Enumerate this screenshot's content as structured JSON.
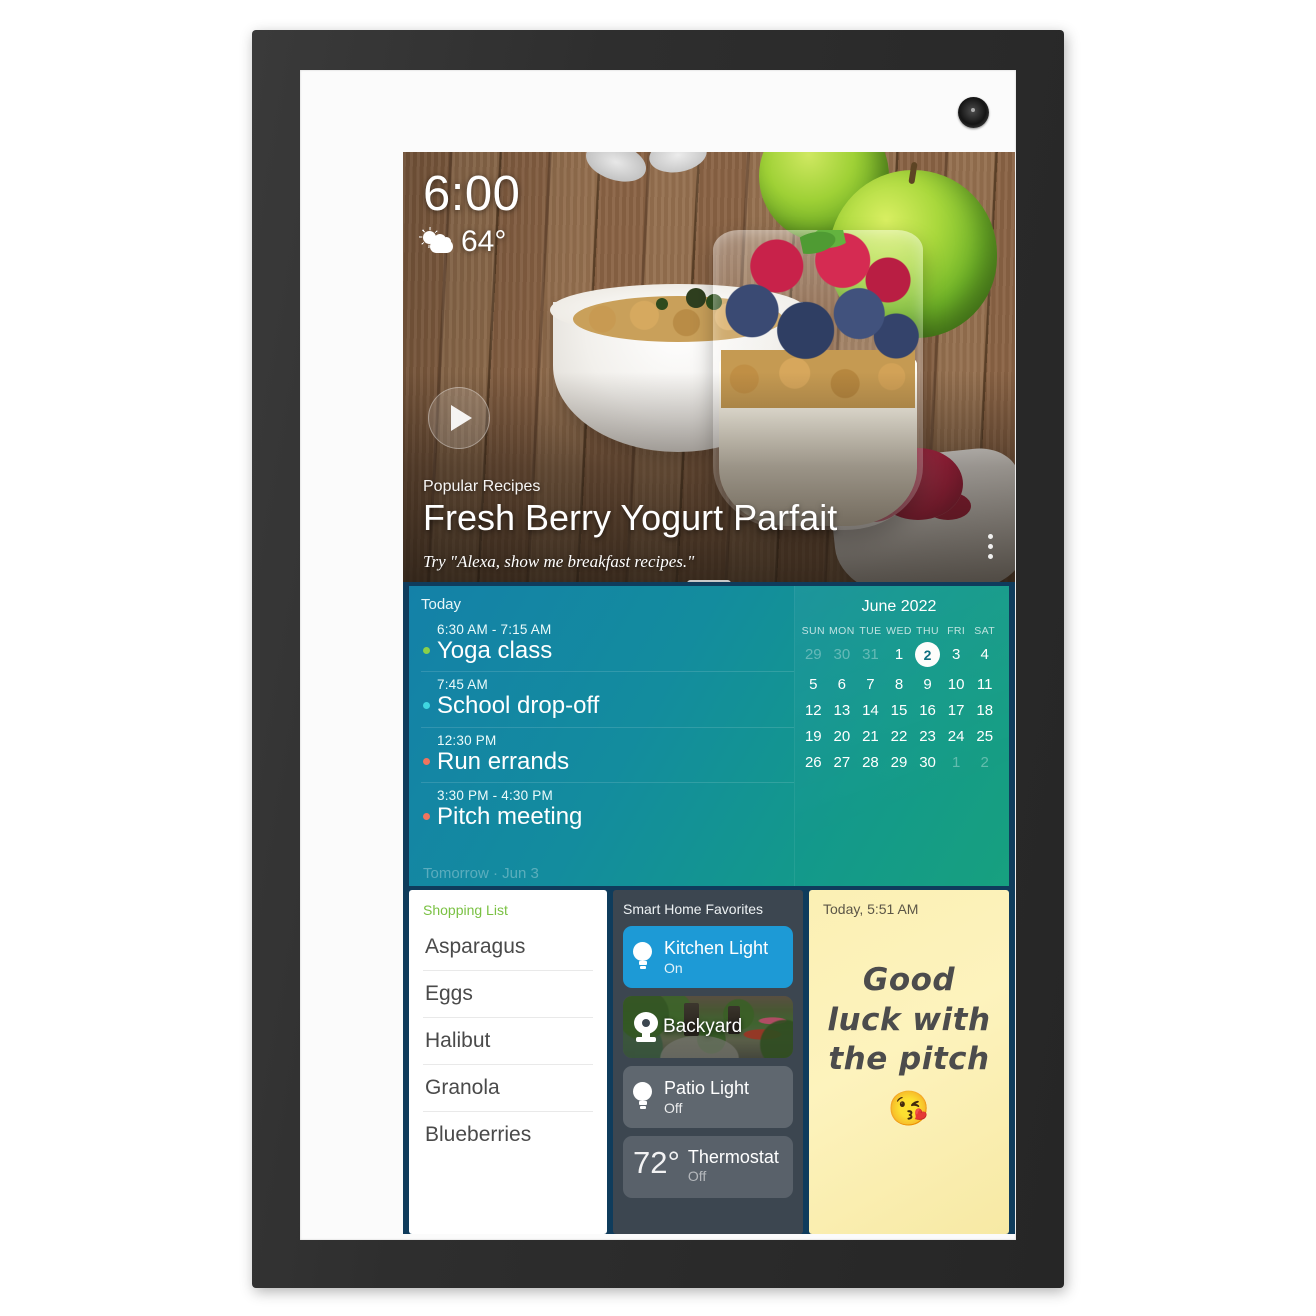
{
  "device": {
    "camera_icon": "camera-lens"
  },
  "status": {
    "time": "6:00",
    "temperature": "64°",
    "weather_icon": "partly-cloudy-icon"
  },
  "hero": {
    "eyebrow": "Popular Recipes",
    "title": "Fresh Berry Yogurt Parfait",
    "hint": "Try \"Alexa, show me breakfast recipes.\"",
    "play_icon": "play-icon",
    "overflow_icon": "more-vertical-icon",
    "grabber_icon": "drag-handle-icon"
  },
  "agenda": {
    "header": "Today",
    "footer": "Tomorrow · Jun 3",
    "events": [
      {
        "time": "6:30 AM - 7:15 AM",
        "name": "Yoga class",
        "dot_color": "#8ad04a"
      },
      {
        "time": "7:45 AM",
        "name": "School drop-off",
        "dot_color": "#3fd6e0"
      },
      {
        "time": "12:30 PM",
        "name": "Run errands",
        "dot_color": "#f0745e"
      },
      {
        "time": "3:30 PM - 4:30 PM",
        "name": "Pitch meeting",
        "dot_color": "#f0745e"
      }
    ]
  },
  "calendar": {
    "title": "June 2022",
    "weekdays": [
      "SUN",
      "MON",
      "TUE",
      "WED",
      "THU",
      "FRI",
      "SAT"
    ],
    "selected_day": 2,
    "weeks": [
      [
        {
          "n": "29",
          "mute": true
        },
        {
          "n": "30",
          "mute": true
        },
        {
          "n": "31",
          "mute": true
        },
        {
          "n": "1"
        },
        {
          "n": "2",
          "sel": true
        },
        {
          "n": "3"
        },
        {
          "n": "4"
        }
      ],
      [
        {
          "n": "5"
        },
        {
          "n": "6"
        },
        {
          "n": "7"
        },
        {
          "n": "8"
        },
        {
          "n": "9"
        },
        {
          "n": "10"
        },
        {
          "n": "11"
        }
      ],
      [
        {
          "n": "12"
        },
        {
          "n": "13"
        },
        {
          "n": "14"
        },
        {
          "n": "15"
        },
        {
          "n": "16"
        },
        {
          "n": "17"
        },
        {
          "n": "18"
        }
      ],
      [
        {
          "n": "19"
        },
        {
          "n": "20"
        },
        {
          "n": "21"
        },
        {
          "n": "22"
        },
        {
          "n": "23"
        },
        {
          "n": "24"
        },
        {
          "n": "25"
        }
      ],
      [
        {
          "n": "26"
        },
        {
          "n": "27"
        },
        {
          "n": "28"
        },
        {
          "n": "29"
        },
        {
          "n": "30"
        },
        {
          "n": "1",
          "mute": true
        },
        {
          "n": "2",
          "mute": true
        }
      ]
    ]
  },
  "shopping_list": {
    "title": "Shopping List",
    "title_color": "#7ac143",
    "items": [
      "Asparagus",
      "Eggs",
      "Halibut",
      "Granola",
      "Blueberries"
    ]
  },
  "smart_home": {
    "title": "Smart Home Favorites",
    "devices": [
      {
        "name": "Kitchen Light",
        "state": "On",
        "type": "light",
        "active": true,
        "icon": "lightbulb-icon"
      },
      {
        "name": "Backyard",
        "state": "",
        "type": "camera",
        "active": false,
        "icon": "camera-icon"
      },
      {
        "name": "Patio Light",
        "state": "Off",
        "type": "light",
        "active": false,
        "icon": "lightbulb-icon"
      },
      {
        "name": "Thermostat",
        "state": "Off",
        "type": "thermostat",
        "active": false,
        "value": "72°",
        "icon": "thermostat-icon"
      }
    ]
  },
  "note": {
    "timestamp": "Today, 5:51 AM",
    "text": "Good luck with the pitch",
    "emoji": "😘"
  }
}
